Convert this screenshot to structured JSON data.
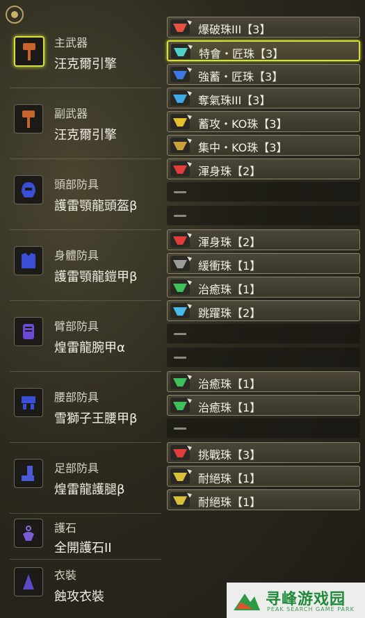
{
  "slots": [
    {
      "type": "主武器",
      "name": "汪克爾引擎",
      "icon": "hammer-icon",
      "selected": true
    },
    {
      "type": "副武器",
      "name": "汪克爾引擎",
      "icon": "hammer-icon",
      "selected": false
    },
    {
      "type": "頭部防具",
      "name": "護雷顎龍頭盔β",
      "icon": "helmet-icon",
      "selected": false
    },
    {
      "type": "身體防具",
      "name": "護雷顎龍鎧甲β",
      "icon": "chest-armor-icon",
      "selected": false
    },
    {
      "type": "臂部防具",
      "name": "煌雷龍腕甲α",
      "icon": "gauntlet-icon",
      "selected": false
    },
    {
      "type": "腰部防具",
      "name": "雪獅子王腰甲β",
      "icon": "waist-armor-icon",
      "selected": false
    },
    {
      "type": "足部防具",
      "name": "煌雷龍護腿β",
      "icon": "leg-armor-icon",
      "selected": false
    },
    {
      "type": "護石",
      "name": "全開護石II",
      "icon": "charm-icon",
      "selected": false
    },
    {
      "type": "衣裝",
      "name": "蝕攻衣裝",
      "icon": "mantle-icon",
      "selected": false
    }
  ],
  "decorations": [
    {
      "name": "爆破珠III【3】",
      "color": "#e0533f",
      "empty": false,
      "selected": false
    },
    {
      "name": "特會・匠珠【3】",
      "color": "#4fd0c8",
      "empty": false,
      "selected": true
    },
    {
      "name": "強蓄・匠珠【3】",
      "color": "#3d78e0",
      "empty": false,
      "selected": false
    },
    {
      "name": "奪氣珠III【3】",
      "color": "#3fa8e8",
      "empty": false,
      "selected": false
    },
    {
      "name": "蓄攻・KO珠【3】",
      "color": "#e6c02c",
      "empty": false,
      "selected": false
    },
    {
      "name": "集中・KO珠【3】",
      "color": "#c9a03a",
      "empty": false,
      "selected": false
    },
    {
      "name": "渾身珠【2】",
      "color": "#e03c3c",
      "empty": false,
      "selected": false
    },
    {
      "name": "",
      "color": "",
      "empty": true,
      "selected": false
    },
    {
      "name": "",
      "color": "",
      "empty": true,
      "selected": false
    },
    {
      "name": "渾身珠【2】",
      "color": "#e03c3c",
      "empty": false,
      "selected": false
    },
    {
      "name": "緩衝珠【1】",
      "color": "#9a9a9a",
      "empty": false,
      "selected": false
    },
    {
      "name": "治癒珠【1】",
      "color": "#3fbf5a",
      "empty": false,
      "selected": false
    },
    {
      "name": "跳躍珠【2】",
      "color": "#4ab8e8",
      "empty": false,
      "selected": false
    },
    {
      "name": "",
      "color": "",
      "empty": true,
      "selected": false
    },
    {
      "name": "",
      "color": "",
      "empty": true,
      "selected": false
    },
    {
      "name": "治癒珠【1】",
      "color": "#3fbf5a",
      "empty": false,
      "selected": false
    },
    {
      "name": "治癒珠【1】",
      "color": "#3fbf5a",
      "empty": false,
      "selected": false
    },
    {
      "name": "",
      "color": "",
      "empty": true,
      "selected": false
    },
    {
      "name": "挑戰珠【3】",
      "color": "#e03c3c",
      "empty": false,
      "selected": false
    },
    {
      "name": "耐絕珠【1】",
      "color": "#d8c03a",
      "empty": false,
      "selected": false
    },
    {
      "name": "耐絕珠【1】",
      "color": "#d8c03a",
      "empty": false,
      "selected": false
    }
  ],
  "watermark": {
    "title": "寻峰游戏园",
    "subtitle": "PEAK SEARCH GAME PARK",
    "icon": "peak-logo-icon"
  },
  "colors": {
    "accent": "#d6e23a",
    "icon_blue": "#3b4fd6",
    "icon_orange": "#c8632a"
  }
}
